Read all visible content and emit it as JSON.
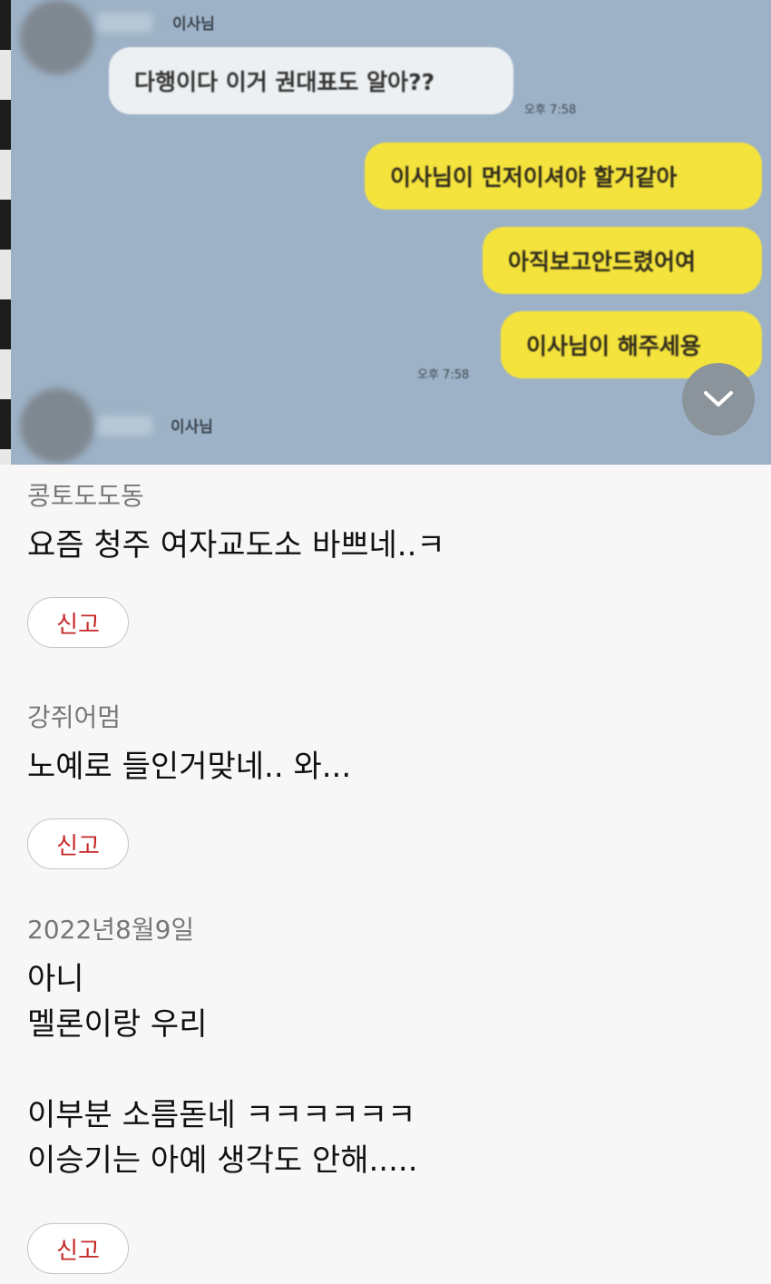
{
  "chat": {
    "sender_top": "이사님",
    "sender_bottom": "이사님",
    "messages": [
      {
        "side": "in",
        "text": "다행이다 이거 권대표도 알아??"
      },
      {
        "side": "out",
        "text": "이사님이 먼저이셔야 할거같아"
      },
      {
        "side": "out",
        "text": "아직보고안드렸어여"
      },
      {
        "side": "out",
        "text": "이사님이 해주세용"
      }
    ],
    "time_1": "오후 7:58",
    "time_2": "오후 7:58",
    "scroll_icon": "chevron-down-icon"
  },
  "comments": [
    {
      "author": "콩토도도동",
      "text": "요즘 청주 여자교도소 바쁘네..ㅋ",
      "report_label": "신고"
    },
    {
      "author": "강쥐어멈",
      "text": "노예로 들인거맞네.. 와...",
      "report_label": "신고"
    },
    {
      "author": "2022년8월9일",
      "text": "아니\n멜론이랑 우리\n\n이부분 소름돋네 ㅋㅋㅋㅋㅋㅋ\n이승기는 아예 생각도 안해.....",
      "report_label": "신고"
    }
  ],
  "colors": {
    "outgoing_bubble": "#f4e33c",
    "incoming_bubble": "#edf0f2",
    "report_text": "#c62828",
    "chat_bg": "#9db2c6"
  }
}
